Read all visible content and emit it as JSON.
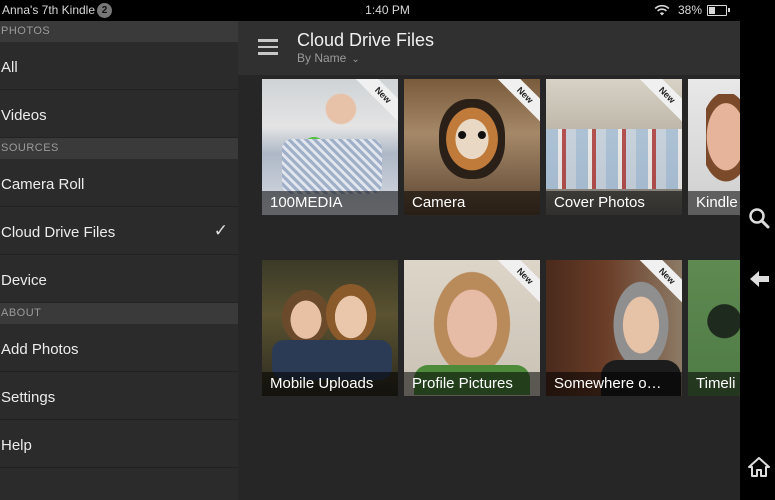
{
  "status": {
    "device_name": "Anna's 7th Kindle",
    "notification_count": "2",
    "time": "1:40 PM",
    "battery": "38%",
    "battery_level": 0.38
  },
  "sidebar": {
    "sections": [
      {
        "header": "PHOTOS",
        "items": [
          "All",
          "Videos"
        ]
      },
      {
        "header": "SOURCES",
        "items": [
          "Camera Roll",
          "Cloud Drive Files",
          "Device"
        ]
      },
      {
        "header": "ABOUT",
        "items": [
          "Add Photos",
          "Settings",
          "Help"
        ]
      }
    ],
    "selected_item": "Cloud Drive Files",
    "checkmark": "✓"
  },
  "header": {
    "title": "Cloud Drive Files",
    "sort": "By Name"
  },
  "badge_text": "New",
  "folders": [
    {
      "name": "100MEDIA",
      "new": true
    },
    {
      "name": "Camera",
      "new": true
    },
    {
      "name": "Cover Photos",
      "new": true
    },
    {
      "name": "Kindle",
      "new": false
    },
    {
      "name": "Mobile Uploads",
      "new": false
    },
    {
      "name": "Profile Pictures",
      "new": true
    },
    {
      "name": "Somewhere o…",
      "new": true
    },
    {
      "name": "Timeli",
      "new": false
    }
  ],
  "icons": {
    "menu": "hamburger-menu-icon",
    "search": "search-icon",
    "back": "back-arrow-icon",
    "home": "home-icon",
    "wifi": "wifi-icon",
    "battery": "battery-icon"
  }
}
